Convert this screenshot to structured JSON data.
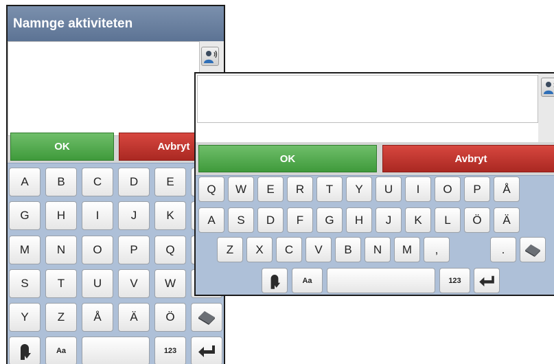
{
  "portrait": {
    "title": "Namnge aktiviteten",
    "text_value": "",
    "ok_label": "OK",
    "cancel_label": "Avbryt",
    "keys": [
      [
        "A",
        "B",
        "C",
        "D",
        "E"
      ],
      [
        "G",
        "H",
        "I",
        "J",
        "K"
      ],
      [
        "M",
        "N",
        "O",
        "P",
        "Q"
      ],
      [
        "S",
        "T",
        "U",
        "V",
        "W"
      ],
      [
        "Y",
        "Z",
        "Å",
        "Ä",
        "Ö"
      ]
    ],
    "case_label": "Aa",
    "numbers_label": "123"
  },
  "landscape": {
    "text_value": "",
    "ok_label": "OK",
    "cancel_label": "Avbryt",
    "row1": [
      "Q",
      "W",
      "E",
      "R",
      "T",
      "Y",
      "U",
      "I",
      "O",
      "P",
      "Å"
    ],
    "row2": [
      "A",
      "S",
      "D",
      "F",
      "G",
      "H",
      "J",
      "K",
      "L",
      "Ö",
      "Ä"
    ],
    "row3": [
      "Z",
      "X",
      "C",
      "V",
      "B",
      "N",
      "M",
      ",",
      "."
    ],
    "case_label": "Aa",
    "numbers_label": "123"
  },
  "colors": {
    "ok": "#4caf50",
    "cancel": "#c0342d",
    "keyboard_bg": "#aec0d8",
    "title_bar": "#6a80a0"
  },
  "icons": [
    "microphone-person-icon",
    "eraser-icon",
    "shift-icon",
    "enter-icon"
  ]
}
